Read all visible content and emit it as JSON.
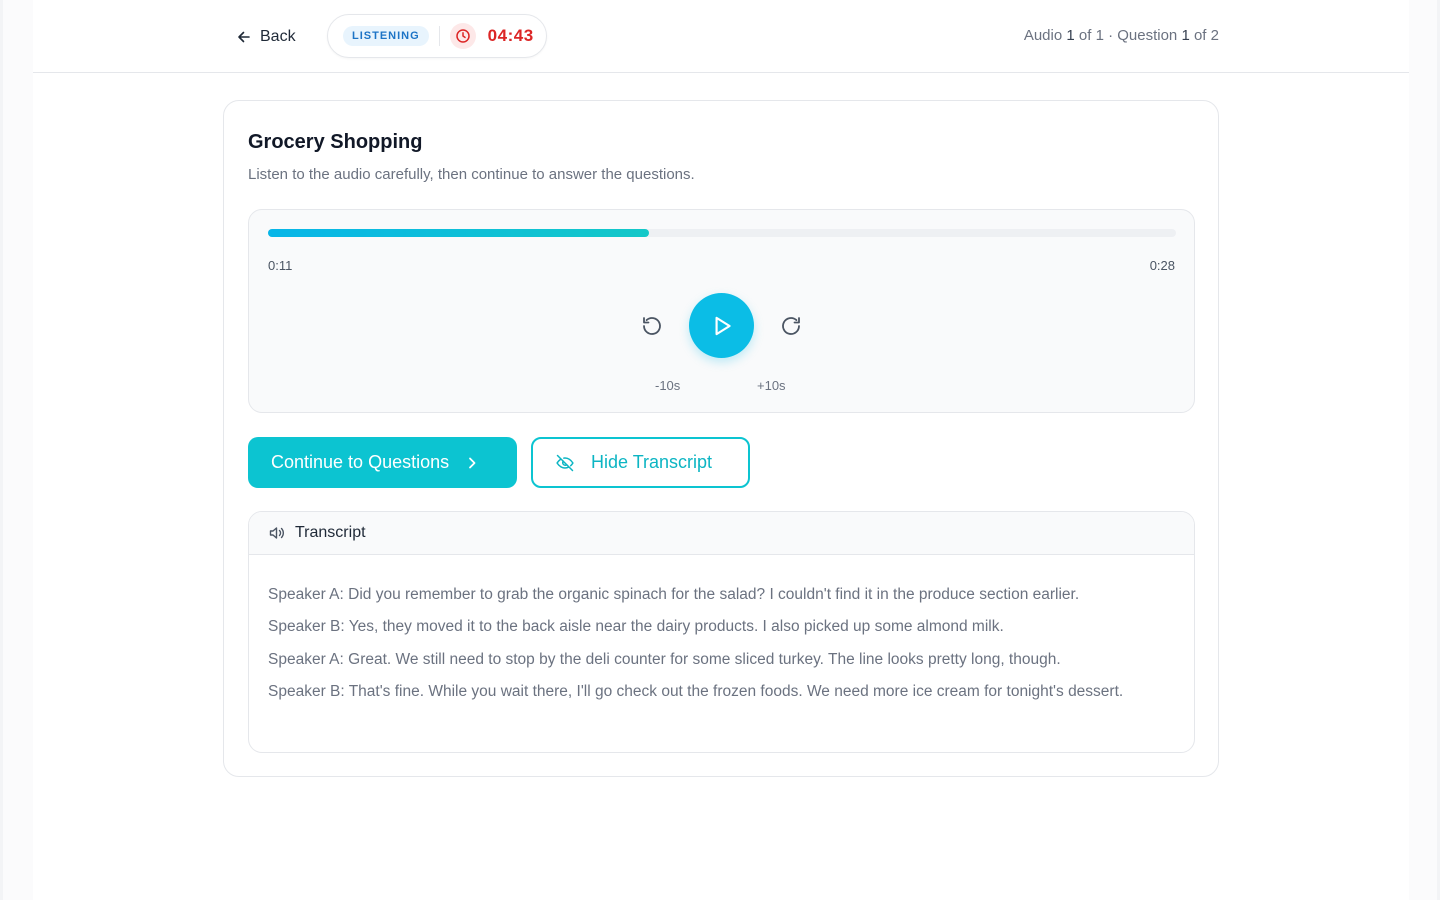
{
  "header": {
    "back_label": "Back",
    "mode_badge": "LISTENING",
    "timer": "04:43",
    "progress": {
      "audio_word": "Audio",
      "audio_current": "1",
      "audio_rest": "of 1 · Question",
      "question_current": "1",
      "question_rest": "of 2"
    }
  },
  "card": {
    "title": "Grocery Shopping",
    "subtitle": "Listen to the audio carefully, then continue to answer the questions."
  },
  "player": {
    "current_time": "0:11",
    "duration": "0:28",
    "progress_fraction": 0.42,
    "skip_back_label": "-10s",
    "skip_forward_label": "+10s"
  },
  "actions": {
    "continue_label": "Continue to Questions",
    "hide_transcript_label": "Hide Transcript"
  },
  "transcript": {
    "heading": "Transcript",
    "lines": [
      "Speaker A: Did you remember to grab the organic spinach for the salad? I couldn't find it in the produce section earlier.",
      "Speaker B: Yes, they moved it to the back aisle near the dairy products. I also picked up some almond milk.",
      "Speaker A: Great. We still need to stop by the deli counter for some sliced turkey. The line looks pretty long, though.",
      "Speaker B: That's fine. While you wait there, I'll go check out the frozen foods. We need more ice cream for tonight's dessert."
    ]
  },
  "colors": {
    "accent": "#0cc4d1",
    "play": "#0bbde6",
    "timer": "#dc2626",
    "badge_text": "#1d74c6",
    "badge_bg": "#e8f4fd"
  }
}
